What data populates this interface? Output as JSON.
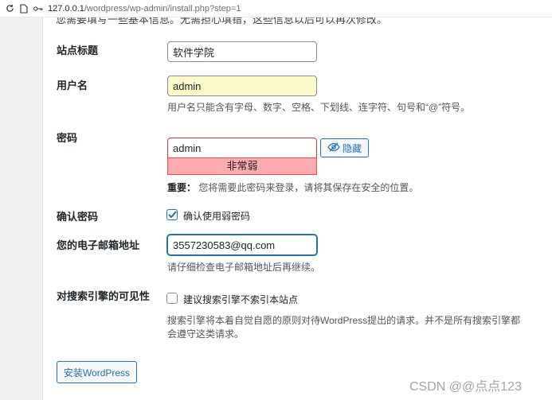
{
  "browser": {
    "url_host": "127.0.0.1",
    "url_path": "/wordpress/wp-admin/install.php?step=1"
  },
  "intro_cut": "您需要填写一些基本信息。无需担心填错，这些信息以后可以再次修改。",
  "site_title": {
    "label": "站点标题",
    "value": "软件学院"
  },
  "username": {
    "label": "用户名",
    "value": "admin",
    "hint": "用户名只能含有字母、数字、空格、下划线、连字符、句号和“@”符号。"
  },
  "password": {
    "label": "密码",
    "value": "admin",
    "hide_label": "隐藏",
    "strength": "非常弱",
    "note_strong": "重要：",
    "note": "您将需要此密码来登录，请将其保存在安全的位置。"
  },
  "confirm": {
    "label": "确认密码",
    "checkbox_label": "确认使用弱密码",
    "checked": true
  },
  "email": {
    "label": "您的电子邮箱地址",
    "value": "3557230583@qq.com",
    "hint": "请仔细检查电子邮箱地址后再继续。"
  },
  "visibility": {
    "label": "对搜索引擎的可见性",
    "checkbox_label": "建议搜索引擎不索引本站点",
    "checked": false,
    "hint_line1": "搜索引擎将本着自觉自愿的原则对待WordPress提出的请求。并不是所有搜索引擎都",
    "hint_line2": "会遵守这类请求。"
  },
  "install_button": "安装WordPress",
  "watermark": "CSDN @@点点123",
  "colors": {
    "accent": "#2271b1",
    "weak_bg": "#ffabaf",
    "autofill_bg": "#fcf9c8"
  }
}
